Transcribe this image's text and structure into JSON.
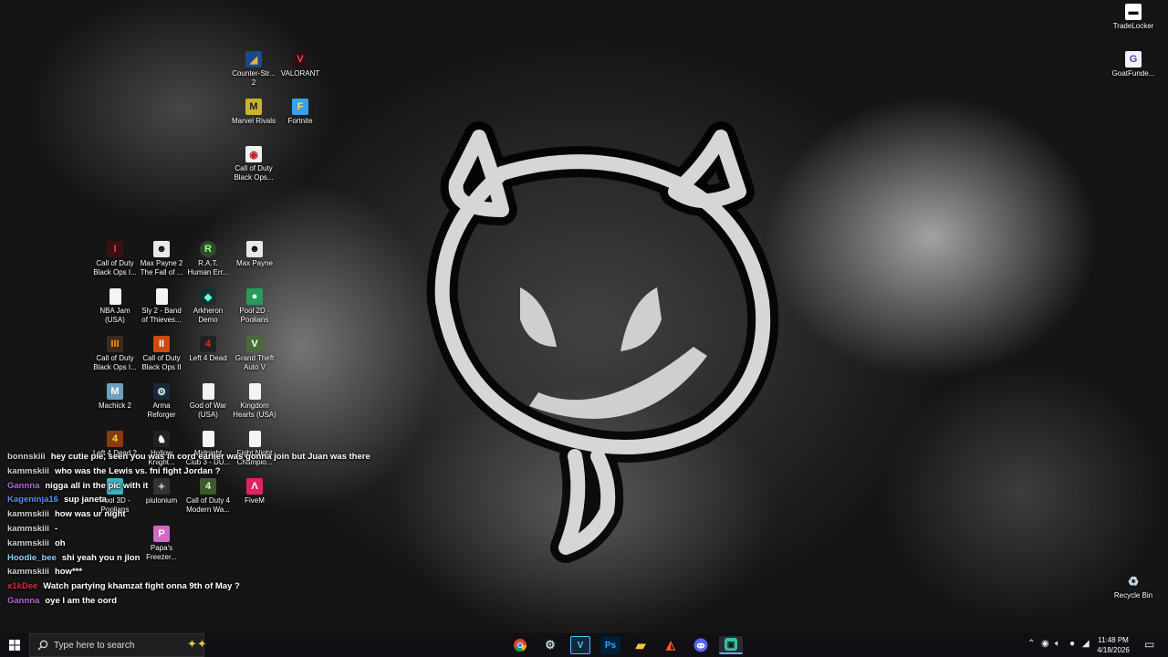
{
  "desktop_icons": {
    "cs2": "Counter-Str...\n2",
    "valorant": "VALORANT",
    "marvel": "Marvel Rivals",
    "fortnite": "Fortnite",
    "cod_bo": "Call of Duty\nBlack Ops...",
    "cod_bo1": "Call of Duty\nBlack Ops I...",
    "maxpayne2": "Max Payne 2\nThe Fall of ...",
    "rat": "R.A.T.\nHuman Err...",
    "maxpayne": "Max Payne",
    "nbajam": "NBA Jam\n(USA)",
    "sly2": "Sly 2 - Band\nof Thieves...",
    "arkheron": "Arkheron\nDemo",
    "pool2d": "Pool 2D -\nPoolians",
    "cod_bo_iii": "Call of Duty\nBlack Ops I...",
    "cod_bo2": "Call of Duty\nBlack Ops II",
    "l4d": "Left 4 Dead",
    "gta5": "Grand Theft\nAuto V",
    "machick": "Machick 2",
    "arma": "Arma\nReforger",
    "gow": "God of War\n(USA)",
    "kh": "Kingdom\nHearts (USA)",
    "l4d2": "Left 4 Dead 2",
    "hollow": "Hollow\nKnight...",
    "midnight": "Midnight\nClub 3 - DU...",
    "fight": "Fight Night\nChampio...",
    "pool3d": "Pool 3D -\nPoolians",
    "piulonium": "piulonium",
    "cod4": "Call of Duty 4\nModern Wa...",
    "fivem": "FiveM",
    "papa": "Papa's\nFreezer...",
    "tradelocker": "TradeLocker",
    "goatfunded": "GoatFunde...",
    "recycle": "Recycle Bin"
  },
  "chat": [
    {
      "user": "bonnskiii",
      "color": "#d0d0d0",
      "msg": "hey cutie pie, seen you was in cord earlier was gonna join but Juan was there"
    },
    {
      "user": "kammskiii",
      "color": "#d0d0d0",
      "msg": "who was the Lewis vs. fni fight Jordan ?"
    },
    {
      "user": "Gannna",
      "color": "#b46ae0",
      "msg": "nigga all in the pic with it"
    },
    {
      "user": "Kageninja16",
      "color": "#5a8cff",
      "msg": "sup janeta"
    },
    {
      "user": "kammskiii",
      "color": "#d0d0d0",
      "msg": "how was ur night"
    },
    {
      "user": "kammskiii",
      "color": "#d0d0d0",
      "msg": "-"
    },
    {
      "user": "kammskiii",
      "color": "#d0d0d0",
      "msg": "oh"
    },
    {
      "user": "Hoodie_bee",
      "color": "#8fd0ff",
      "msg": "shi yeah you n jlon"
    },
    {
      "user": "kammskiii",
      "color": "#d0d0d0",
      "msg": "how***"
    },
    {
      "user": "x1kDee",
      "color": "#d0303a",
      "msg": "Watch partying khamzat fight onna 9th of May ?"
    },
    {
      "user": "Gannna",
      "color": "#b46ae0",
      "msg": "oye I am the oord"
    }
  ],
  "taskbar": {
    "search_placeholder": "Type here to search",
    "apps": [
      "chrome-icon",
      "steam-icon",
      "vegas-icon",
      "photoshop-icon",
      "file-explorer-icon",
      "brave-icon",
      "discord-icon",
      "streamlabs-icon"
    ],
    "time": "11:48 PM",
    "date": "4/18/2026"
  }
}
